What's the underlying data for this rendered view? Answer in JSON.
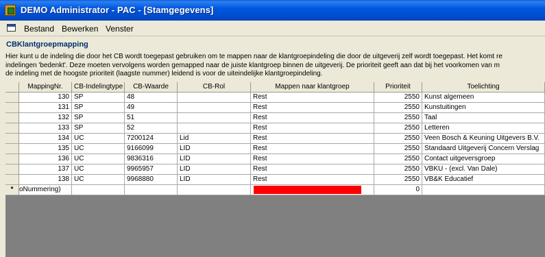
{
  "window": {
    "title": "DEMO Administrator - PAC - [Stamgegevens]"
  },
  "menu": {
    "items": [
      "Bestand",
      "Bewerken",
      "Venster"
    ]
  },
  "form": {
    "title": "CBKlantgroepmapping",
    "description": [
      "Hier kunt u de indeling die door het CB wordt toegepast gebruiken om te mappen naar de klantgroepindeling die door de uitgeverij zelf wordt toegepast. Het komt re",
      "indelingen 'bedenkt'. Deze moeten vervolgens worden gemapped naar de juiste klantgroep binnen de uitgeverij. De prioriteit geeft aan dat bij het voorkomen van m",
      "de indeling met de hoogste prioriteit (laagste nummer) leidend is voor de uiteindelijke klantgroepindeling."
    ]
  },
  "table": {
    "headers": [
      "MappingNr.",
      "CB-Indelingtype",
      "CB-Waarde",
      "CB-Rol",
      "Mappen naar klantgroep",
      "Prioriteit",
      "Toelichting"
    ],
    "rows": [
      [
        "130",
        "SP",
        "48",
        "",
        "Rest",
        "2550",
        "Kunst algemeen"
      ],
      [
        "131",
        "SP",
        "49",
        "",
        "Rest",
        "2550",
        "Kunstuitingen"
      ],
      [
        "132",
        "SP",
        "51",
        "",
        "Rest",
        "2550",
        "Taal"
      ],
      [
        "133",
        "SP",
        "52",
        "",
        "Rest",
        "2550",
        "Letteren"
      ],
      [
        "134",
        "UC",
        "7200124",
        "Lid",
        "Rest",
        "2550",
        "Veen Bosch & Keuning Uitgevers B.V."
      ],
      [
        "135",
        "UC",
        "9166099",
        "LID",
        "Rest",
        "2550",
        "Standaard Uitgeverij Concern Verslag"
      ],
      [
        "136",
        "UC",
        "9836316",
        "LID",
        "Rest",
        "2550",
        "Contact uitgeversgroep"
      ],
      [
        "137",
        "UC",
        "9965957",
        "LID",
        "Rest",
        "2550",
        "VBKU - (excl. Van Dale)"
      ],
      [
        "138",
        "UC",
        "9968880",
        "LID",
        "Rest",
        "2550",
        "VB&K Educatief"
      ]
    ],
    "new_row": {
      "marker": "*",
      "mapping_placeholder": "oNummering)",
      "priority": "0",
      "mapping_fill_color": "#ff0000"
    }
  }
}
